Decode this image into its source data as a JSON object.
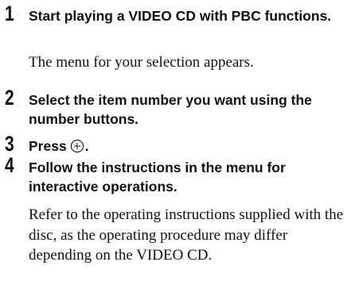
{
  "steps": [
    {
      "number": "1",
      "heading": "Start playing a VIDEO CD with PBC functions.",
      "body": "The menu for your selection appears."
    },
    {
      "number": "2",
      "heading": "Select the item number you want using the number buttons."
    },
    {
      "number": "3",
      "heading_prefix": "Press",
      "icon": "enter-button-icon",
      "heading_suffix": "."
    },
    {
      "number": "4",
      "heading": "Follow the instructions in the menu for interactive operations.",
      "body": "Refer to the operating instructions supplied with the disc, as the operating procedure may differ depending on the VIDEO CD."
    }
  ]
}
